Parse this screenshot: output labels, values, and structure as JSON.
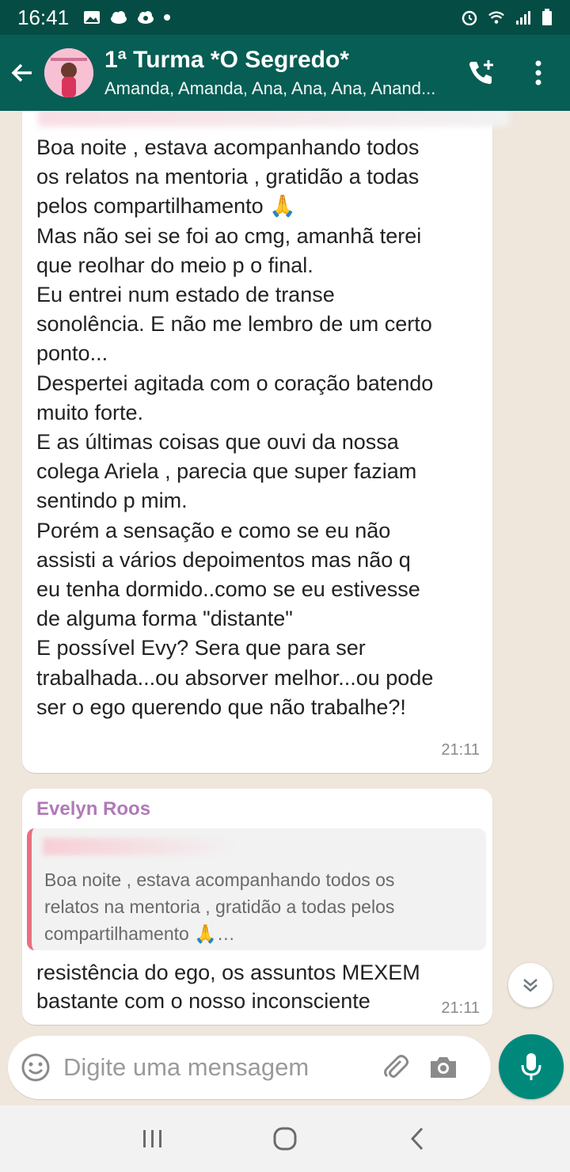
{
  "status_bar": {
    "time": "16:41",
    "icons_left": [
      "gallery-icon",
      "cloud-icon",
      "cloud-sync-icon",
      "dot-icon"
    ],
    "icons_right": [
      "alarm-icon",
      "wifi-icon",
      "signal-icon",
      "battery-icon"
    ]
  },
  "header": {
    "title": "1ª Turma *O Segredo*",
    "subtitle": "Amanda, Amanda, Ana, Ana, Ana, Anand...",
    "back_icon": "arrow-back-icon",
    "call_icon": "add-call-icon",
    "menu_icon": "more-vert-icon",
    "colors": {
      "header": "#075e54",
      "status": "#054d44"
    }
  },
  "messages": [
    {
      "text": "Boa noite , estava acompanhando todos\nos relatos na mentoria , gratidão a todas\npelos compartilhamento 🙏\nMas não sei se foi ao cmg, amanhã terei\nque reolhar do meio p o final.\nEu entrei num estado de transe\nsonolência. E não me lembro de um certo\nponto...\nDespertei agitada com o coração batendo\nmuito forte.\nE as últimas coisas que ouvi da nossa\ncolega Ariela , parecia que super faziam\nsentindo p mim.\nPorém a sensação e como se eu não\nassisti a vários depoimentos mas não q\neu tenha dormido..como se eu estivesse\nde alguma forma \"distante\"\nE possível Evy? Sera que para ser\ntrabalhada...ou absorver melhor...ou pode\nser o ego querendo que não trabalhe?!",
      "time": "21:11"
    },
    {
      "sender": "Evelyn Roos",
      "quote": "Boa noite , estava acompanhando todos os\nrelatos na mentoria , gratidão a todas pelos\ncompartilhamento 🙏…",
      "text": "resistência do ego, os assuntos MEXEM\nbastante com o nosso inconsciente",
      "time": "21:11"
    }
  ],
  "composer": {
    "placeholder": "Digite uma mensagem",
    "emoji_icon": "emoji-icon",
    "attach_icon": "paperclip-icon",
    "camera_icon": "camera-icon",
    "mic_icon": "mic-icon",
    "accent": "#00897b"
  },
  "navigation": {
    "buttons": [
      "recent-apps-icon",
      "home-icon",
      "back-icon"
    ]
  }
}
